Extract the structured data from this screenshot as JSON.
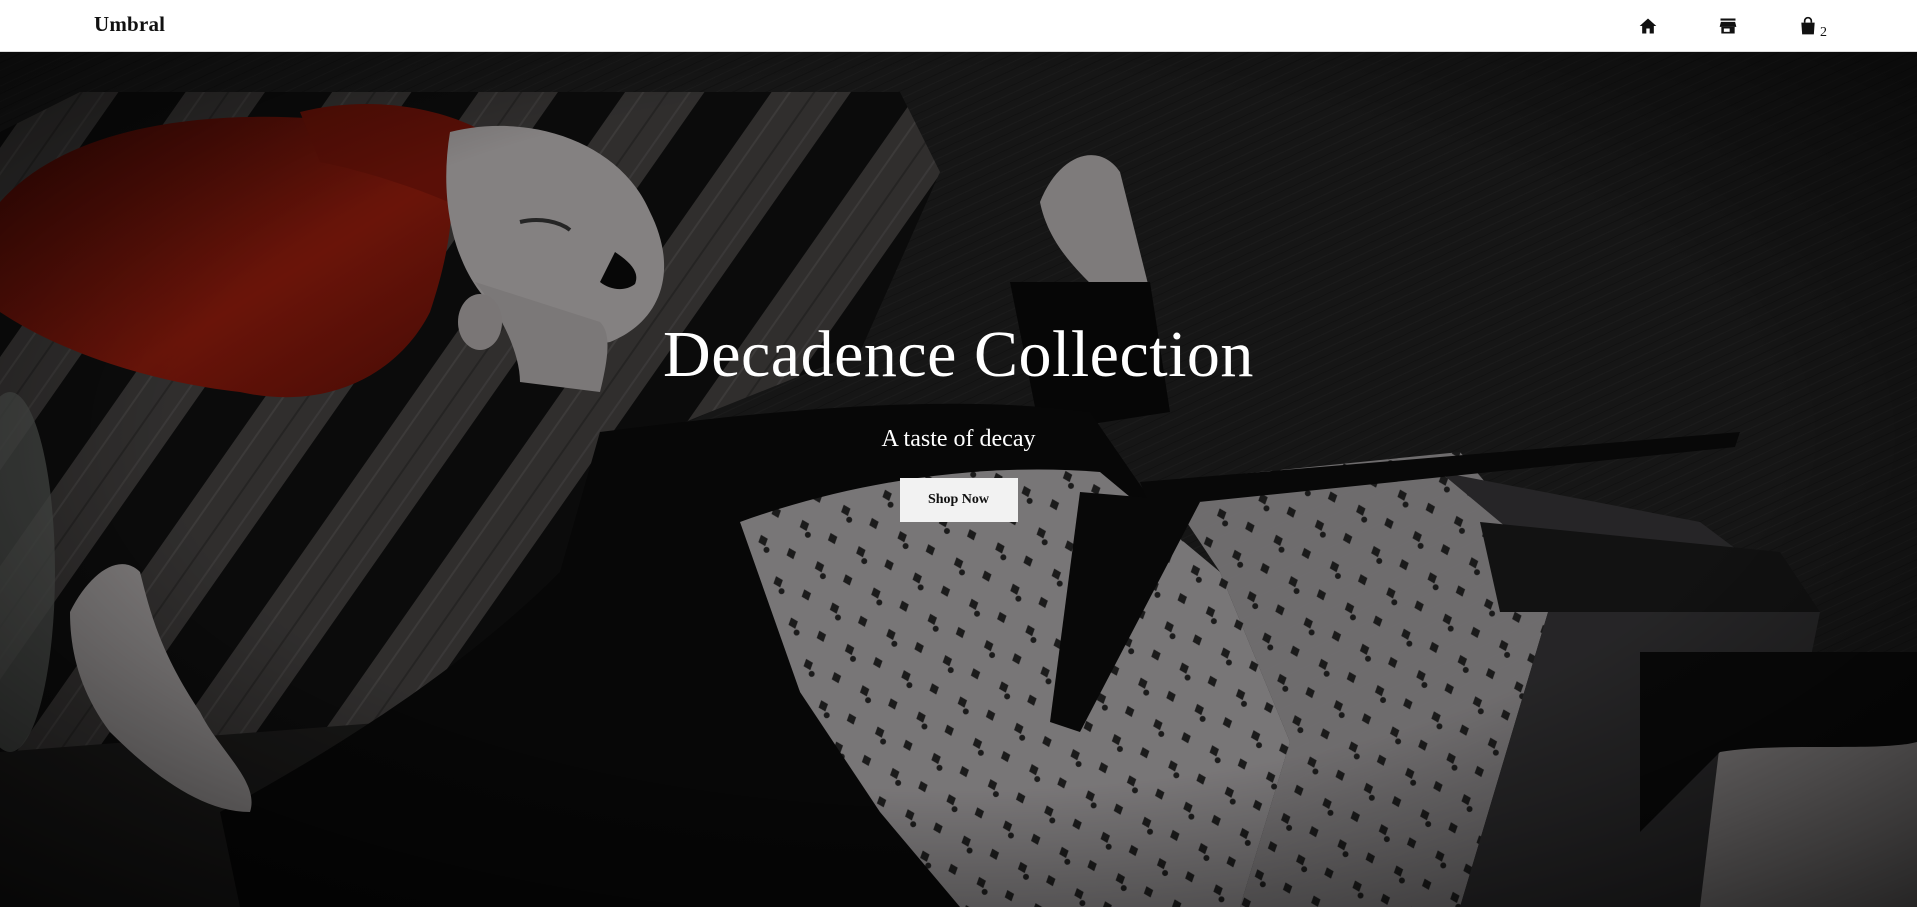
{
  "nav": {
    "brand": "Umbral",
    "home_icon": "home-icon",
    "store_icon": "store-icon",
    "cart_icon": "shopping-bag-icon",
    "cart_count": "2"
  },
  "hero": {
    "title": "Decadence Collection",
    "subtitle": "A taste of decay",
    "button_label": "Shop Now",
    "image_description_colors": {
      "background": "#1a1a1a",
      "hair": "#8a1a10",
      "skin": "#c9c4c4",
      "fabric_dark": "#0b0b0b",
      "satin": "#b8b4b6"
    }
  }
}
